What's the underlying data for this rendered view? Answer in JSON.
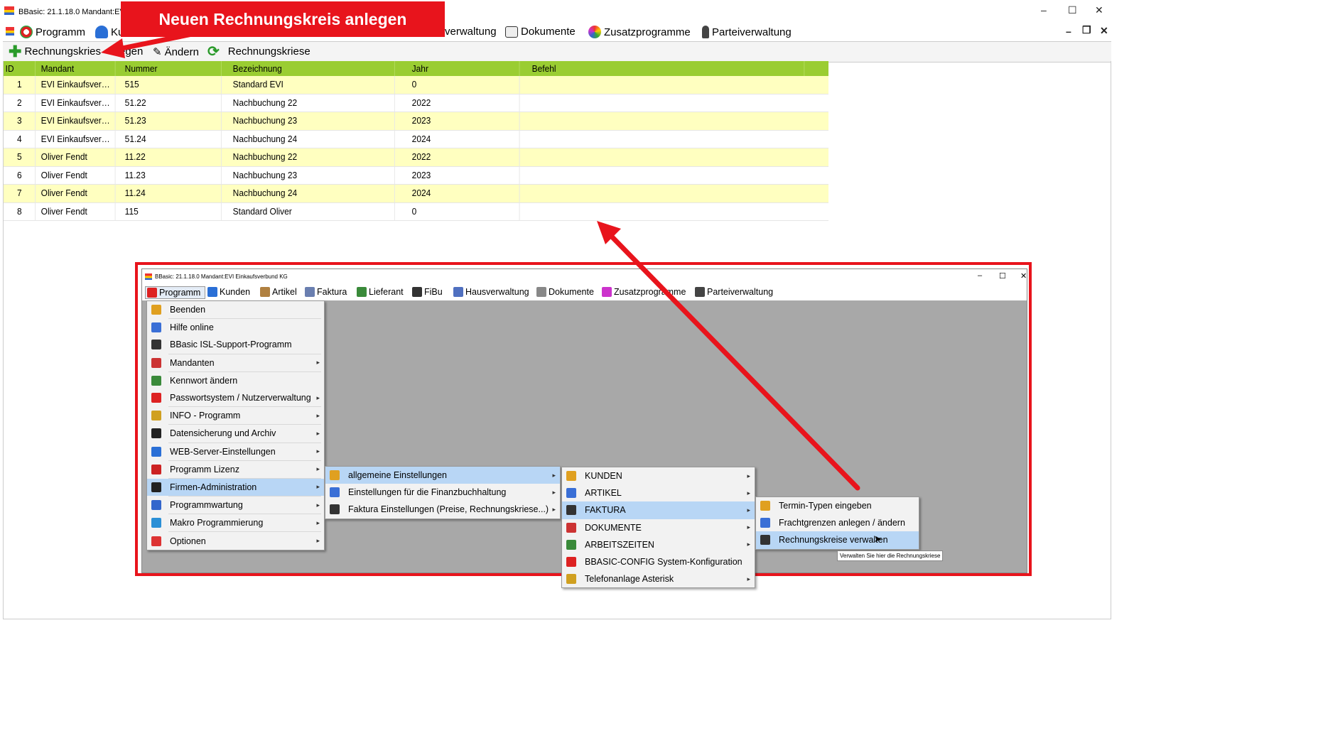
{
  "window": {
    "title": "BBasic: 21.1.18.0 Mandant:EVI Ein",
    "minimize": "–",
    "maximize": "☐",
    "close": "✕",
    "mdi_minimize": "–",
    "mdi_restore": "❐",
    "mdi_close": "✕"
  },
  "menubar": {
    "items": [
      {
        "label": "Programm",
        "icon": "programm-icon"
      },
      {
        "label": "Ku",
        "icon": "kunden-icon"
      },
      {
        "label": "verwaltung",
        "icon": "hausverwaltung-icon"
      },
      {
        "label": "Dokumente",
        "icon": "dokumente-icon"
      },
      {
        "label": "Zusatzprogramme",
        "icon": "zusatzprogramme-icon"
      },
      {
        "label": "Parteiverwaltung",
        "icon": "parteiverwaltung-icon"
      }
    ]
  },
  "toolbar": {
    "new_label": "Rechnungskries",
    "new_label_rest": "egen",
    "edit_label": "Ändern",
    "refresh_label": "Rechnungskriese"
  },
  "callout": {
    "text": "Neuen Rechnungskreis anlegen",
    "color": "#e8141c"
  },
  "grid": {
    "columns": [
      "ID",
      "Mandant",
      "Nummer",
      "Bezeichnung",
      "Jahr",
      "Befehl"
    ],
    "header_color": "#9acd32",
    "alt_row_color": "#ffffc0",
    "rows": [
      {
        "id": "1",
        "mandant": "EVI  Einkaufsverbund KG",
        "nummer": "515",
        "bezeichnung": "Standard EVI",
        "jahr": "0",
        "befehl": ""
      },
      {
        "id": "2",
        "mandant": "EVI  Einkaufsverbund KG",
        "nummer": "51.22",
        "bezeichnung": "Nachbuchung 22",
        "jahr": "2022",
        "befehl": ""
      },
      {
        "id": "3",
        "mandant": "EVI  Einkaufsverbund KG",
        "nummer": "51.23",
        "bezeichnung": "Nachbuchung 23",
        "jahr": "2023",
        "befehl": ""
      },
      {
        "id": "4",
        "mandant": "EVI  Einkaufsverbund KG",
        "nummer": "51.24",
        "bezeichnung": "Nachbuchung 24",
        "jahr": "2024",
        "befehl": ""
      },
      {
        "id": "5",
        "mandant": "Oliver Fendt",
        "nummer": "11.22",
        "bezeichnung": "Nachbuchung 22",
        "jahr": "2022",
        "befehl": ""
      },
      {
        "id": "6",
        "mandant": "Oliver Fendt",
        "nummer": "11.23",
        "bezeichnung": "Nachbuchung 23",
        "jahr": "2023",
        "befehl": ""
      },
      {
        "id": "7",
        "mandant": "Oliver Fendt",
        "nummer": "11.24",
        "bezeichnung": "Nachbuchung 24",
        "jahr": "2024",
        "befehl": ""
      },
      {
        "id": "8",
        "mandant": "Oliver Fendt",
        "nummer": "115",
        "bezeichnung": "Standard Oliver",
        "jahr": "0",
        "befehl": ""
      }
    ]
  },
  "inset": {
    "title": "BBasic: 21.1.18.0 Mandant:EVI Einkaufsverbund KG",
    "menubar": [
      {
        "label": "Programm",
        "icon": "programm-icon"
      },
      {
        "label": "Kunden",
        "icon": "kunden-icon"
      },
      {
        "label": "Artikel",
        "icon": "artikel-icon"
      },
      {
        "label": "Faktura",
        "icon": "faktura-icon"
      },
      {
        "label": "Lieferant",
        "icon": "lieferant-icon"
      },
      {
        "label": "FiBu",
        "icon": "fibu-icon"
      },
      {
        "label": "Hausverwaltung",
        "icon": "hausverwaltung-icon"
      },
      {
        "label": "Dokumente",
        "icon": "dokumente-icon"
      },
      {
        "label": "Zusatzprogramme",
        "icon": "zusatzprogramme-icon"
      },
      {
        "label": "Parteiverwaltung",
        "icon": "parteiverwaltung-icon"
      }
    ],
    "menu1": [
      {
        "label": "Beenden",
        "icon": "exit-icon"
      },
      {
        "label": "Hilfe online",
        "icon": "help-online-icon"
      },
      {
        "label": "BBasic ISL-Support-Programm",
        "icon": "support-icon"
      },
      {
        "label": "Mandanten",
        "icon": "mandanten-icon",
        "sub": true
      },
      {
        "label": "Kennwort ändern",
        "icon": "lock-icon"
      },
      {
        "label": "Passwortsystem / Nutzerverwaltung",
        "icon": "users-icon",
        "sub": true
      },
      {
        "label": "INFO - Programm",
        "icon": "info-icon",
        "sub": true
      },
      {
        "label": "Datensicherung und Archiv",
        "icon": "zip-icon",
        "sub": true
      },
      {
        "label": "WEB-Server-Einstellungen",
        "icon": "web-icon",
        "sub": true
      },
      {
        "label": "Programm Lizenz",
        "icon": "key-icon",
        "sub": true
      },
      {
        "label": "Firmen-Administration",
        "icon": "gear-icon",
        "sub": true,
        "selected": true
      },
      {
        "label": "Programmwartung",
        "icon": "tools-icon",
        "sub": true
      },
      {
        "label": "Makro Programmierung",
        "icon": "macro-icon",
        "sub": true
      },
      {
        "label": "Optionen",
        "icon": "options-icon",
        "sub": true
      }
    ],
    "menu2": [
      {
        "label": "allgemeine Einstellungen",
        "icon": "gear-icon",
        "sub": true,
        "selected": true
      },
      {
        "label": "Einstellungen für die Finanzbuchhaltung",
        "icon": "gear-icon",
        "sub": true
      },
      {
        "label": "Faktura Einstellungen (Preise, Rechnungskriese...)",
        "icon": "gear-icon",
        "sub": true
      }
    ],
    "menu3": [
      {
        "label": "KUNDEN",
        "icon": "kunden-icon",
        "sub": true
      },
      {
        "label": "ARTIKEL",
        "icon": "artikel-icon",
        "sub": true
      },
      {
        "label": "FAKTURA",
        "icon": "faktura-icon",
        "sub": true,
        "selected": true
      },
      {
        "label": "DOKUMENTE",
        "icon": "dokumente-icon",
        "sub": true
      },
      {
        "label": "ARBEITSZEITEN",
        "icon": "clock-icon",
        "sub": true
      },
      {
        "label": "BBASIC-CONFIG System-Konfiguration",
        "icon": "config-icon"
      },
      {
        "label": "Telefonanlage Asterisk",
        "icon": "asterisk-icon",
        "sub": true
      }
    ],
    "menu4": [
      {
        "label": "Termin-Typen eingeben",
        "icon": "termin-icon"
      },
      {
        "label": "Frachtgrenzen anlegen / ändern",
        "icon": "fracht-icon"
      },
      {
        "label": "Rechnungskreise verwalten",
        "icon": "rechnungskreise-icon",
        "selected": true
      }
    ],
    "tooltip": "Verwalten Sie hier die Rechnungskriese"
  }
}
